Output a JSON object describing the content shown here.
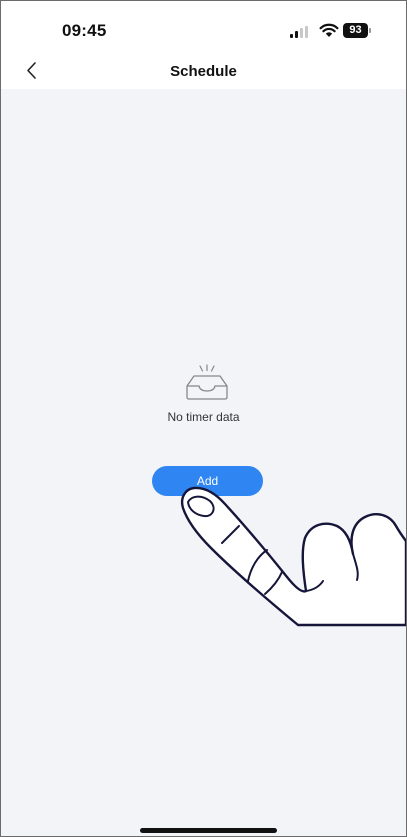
{
  "status_bar": {
    "time": "09:45",
    "battery_level": "93",
    "signal_icon": "cellular-signal-icon",
    "wifi_icon": "wifi-icon"
  },
  "nav": {
    "title": "Schedule",
    "back_icon": "chevron-left-icon"
  },
  "empty_state": {
    "icon": "empty-inbox-icon",
    "message": "No timer data"
  },
  "actions": {
    "add_label": "Add"
  },
  "colors": {
    "accent": "#2f86f2",
    "background": "#f3f4f8",
    "header_background": "#ffffff"
  }
}
